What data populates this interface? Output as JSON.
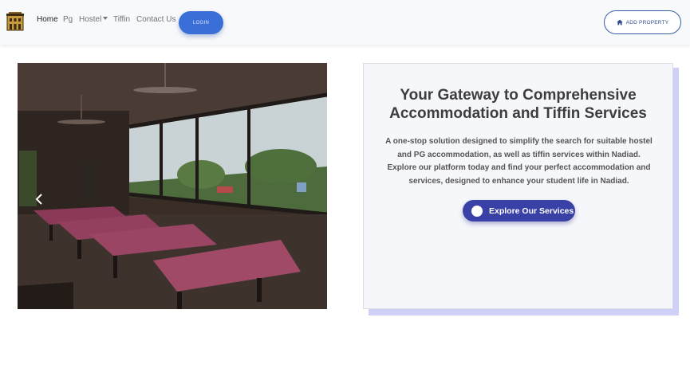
{
  "nav": {
    "logo_icon": "building-logo-icon",
    "links": [
      "Home",
      "Pg",
      "Hostel",
      "Tiffin",
      "Contact Us"
    ],
    "login_label": "LOGIN",
    "add_property_label": "ADD PROPERTY",
    "add_property_icon": "home-icon"
  },
  "hero": {
    "carousel_prev_icon": "chevron-left-icon",
    "title": "Your Gateway to Comprehensive Accommodation and Tiffin Services",
    "description": "A one-stop solution designed to simplify the search for suitable hostel and PG accommodation, as well as tiffin services within Nadiad. Explore our platform today and find your perfect accommodation and services, designed to enhance your student life in Nadiad.",
    "cta_label": "Explore Our Services"
  },
  "colors": {
    "login_button": "#3b6fd8",
    "cta_button": "#3a41a6",
    "card_shadow": "#cfd0f7"
  }
}
